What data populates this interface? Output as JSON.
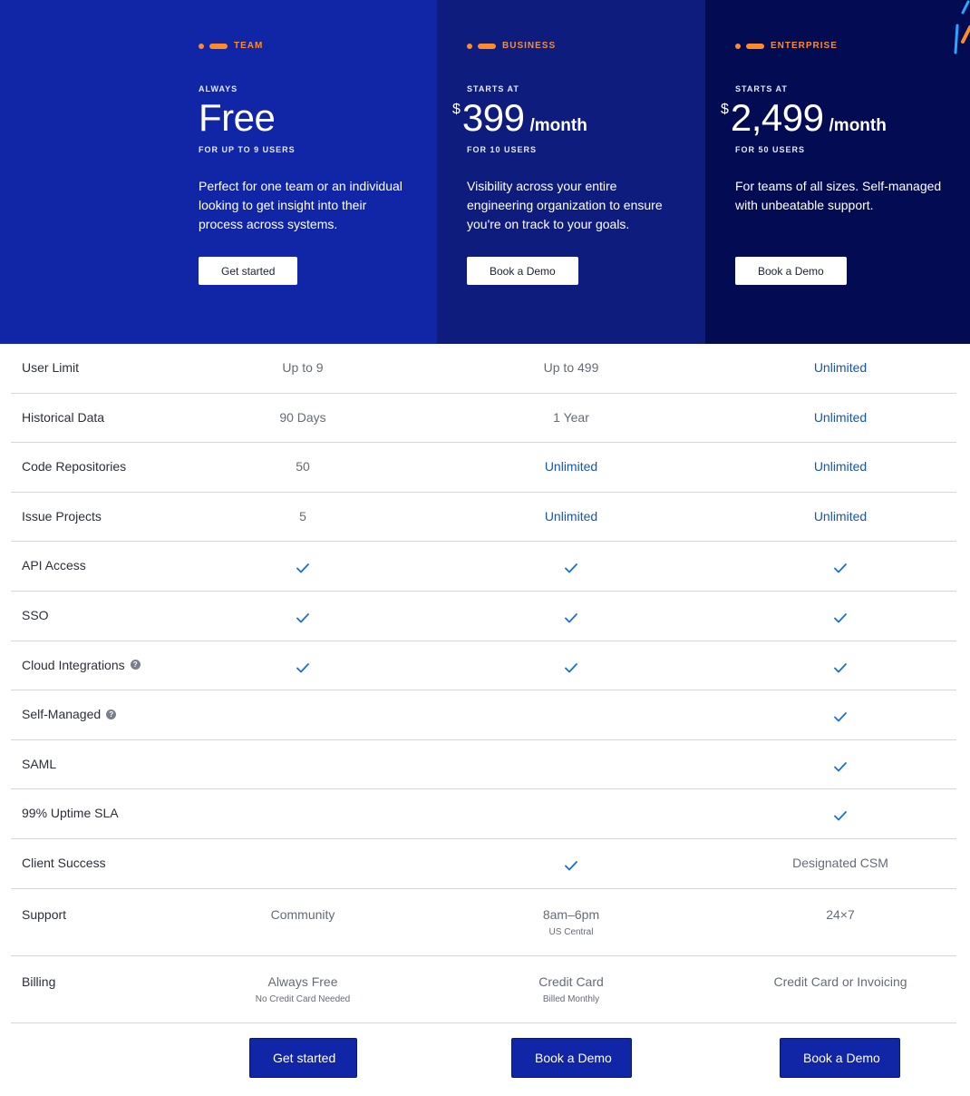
{
  "colors": {
    "team_bg": "#1126a7",
    "business_bg": "#0e1d7d",
    "enterprise_bg": "#030b52",
    "accent_orange": "#ff8a2b",
    "link_blue": "#1756b0",
    "button_blue": "#1126a7"
  },
  "plans": [
    {
      "tag": "TEAM",
      "pre_label": "ALWAYS",
      "currency": "",
      "price": "Free",
      "period": "",
      "users": "FOR UP TO 9 USERS",
      "description": "Perfect for one team or an individual looking to get insight into their process across systems.",
      "button": "Get started"
    },
    {
      "tag": "BUSINESS",
      "pre_label": "STARTS AT",
      "currency": "$",
      "price": "399",
      "period": "/month",
      "users": "FOR 10 USERS",
      "description": "Visibility across your entire engineering organization to ensure you're on track to your goals.",
      "button": "Book a Demo"
    },
    {
      "tag": "ENTERPRISE",
      "pre_label": "STARTS AT",
      "currency": "$",
      "price": "2,499",
      "period": "/month",
      "users": "FOR 50 USERS",
      "description": "For teams of all sizes. Self-managed with unbeatable support.",
      "button": "Book a Demo"
    }
  ],
  "features": [
    {
      "label": "User Limit",
      "help": false,
      "values": [
        {
          "type": "text",
          "text": "Up to 9"
        },
        {
          "type": "text",
          "text": "Up to 499"
        },
        {
          "type": "link",
          "text": "Unlimited"
        }
      ]
    },
    {
      "label": "Historical Data",
      "help": false,
      "values": [
        {
          "type": "text",
          "text": "90 Days"
        },
        {
          "type": "text",
          "text": "1 Year"
        },
        {
          "type": "link",
          "text": "Unlimited"
        }
      ]
    },
    {
      "label": "Code Repositories",
      "help": false,
      "values": [
        {
          "type": "text",
          "text": "50"
        },
        {
          "type": "link",
          "text": "Unlimited"
        },
        {
          "type": "link",
          "text": "Unlimited"
        }
      ]
    },
    {
      "label": "Issue Projects",
      "help": false,
      "values": [
        {
          "type": "text",
          "text": "5"
        },
        {
          "type": "link",
          "text": "Unlimited"
        },
        {
          "type": "link",
          "text": "Unlimited"
        }
      ]
    },
    {
      "label": "API Access",
      "help": false,
      "values": [
        {
          "type": "check"
        },
        {
          "type": "check"
        },
        {
          "type": "check"
        }
      ]
    },
    {
      "label": "SSO",
      "help": false,
      "values": [
        {
          "type": "check"
        },
        {
          "type": "check"
        },
        {
          "type": "check"
        }
      ]
    },
    {
      "label": "Cloud Integrations",
      "help": true,
      "values": [
        {
          "type": "check"
        },
        {
          "type": "check"
        },
        {
          "type": "check"
        }
      ]
    },
    {
      "label": "Self-Managed",
      "help": true,
      "values": [
        {
          "type": "empty"
        },
        {
          "type": "empty"
        },
        {
          "type": "check"
        }
      ]
    },
    {
      "label": "SAML",
      "help": false,
      "values": [
        {
          "type": "empty"
        },
        {
          "type": "empty"
        },
        {
          "type": "check"
        }
      ]
    },
    {
      "label": "99% Uptime SLA",
      "help": false,
      "values": [
        {
          "type": "empty"
        },
        {
          "type": "empty"
        },
        {
          "type": "check"
        }
      ]
    },
    {
      "label": "Client Success",
      "help": false,
      "values": [
        {
          "type": "empty"
        },
        {
          "type": "check"
        },
        {
          "type": "text",
          "text": "Designated CSM"
        }
      ]
    },
    {
      "label": "Support",
      "help": false,
      "values": [
        {
          "type": "text",
          "text": "Community"
        },
        {
          "type": "text",
          "text": "8am–6pm",
          "sub": "US Central"
        },
        {
          "type": "text",
          "text": "24×7"
        }
      ]
    },
    {
      "label": "Billing",
      "help": false,
      "values": [
        {
          "type": "text",
          "text": "Always Free",
          "sub": "No Credit Card Needed"
        },
        {
          "type": "text",
          "text": "Credit Card",
          "sub": "Billed Monthly"
        },
        {
          "type": "text",
          "text": "Credit Card or Invoicing"
        }
      ]
    }
  ],
  "footer_buttons": [
    "Get started",
    "Book a Demo",
    "Book a Demo"
  ],
  "icons": {
    "check": "checkmark-icon",
    "help": "question-circle-icon",
    "bullet": "orange-dot-icon"
  }
}
